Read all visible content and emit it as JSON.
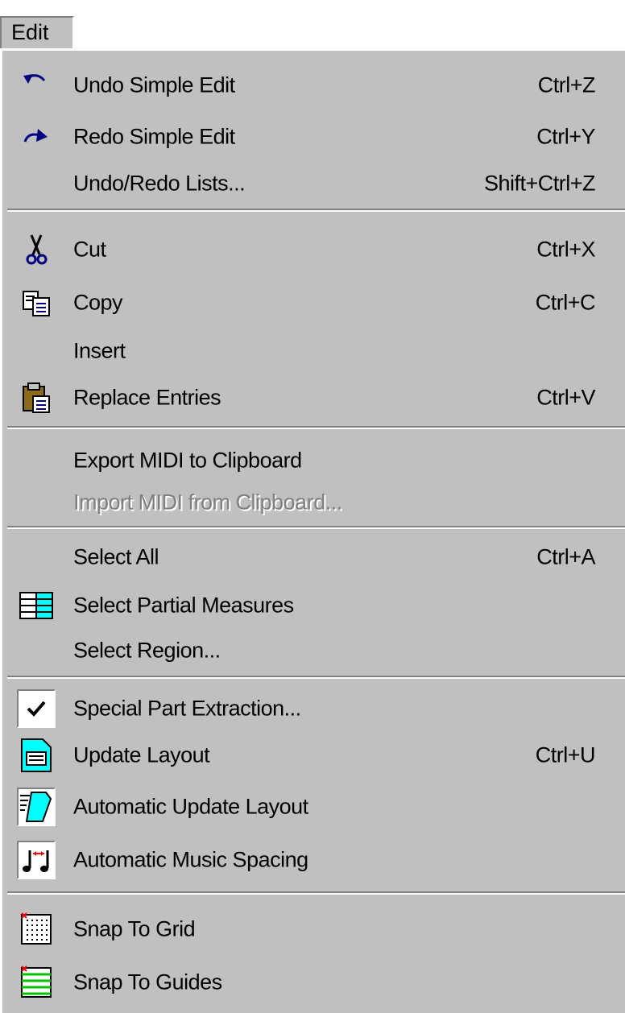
{
  "menu": {
    "title": "Edit",
    "items": {
      "undo": {
        "label": "Undo Simple Edit",
        "shortcut": "Ctrl+Z",
        "icon": "undo-arrow-icon"
      },
      "redo": {
        "label": "Redo Simple Edit",
        "shortcut": "Ctrl+Y",
        "icon": "redo-arrow-icon"
      },
      "undo_redo_lists": {
        "label": "Undo/Redo Lists...",
        "shortcut": "Shift+Ctrl+Z"
      },
      "cut": {
        "label": "Cut",
        "shortcut": "Ctrl+X",
        "icon": "scissors-icon"
      },
      "copy": {
        "label": "Copy",
        "shortcut": "Ctrl+C",
        "icon": "copy-pages-icon"
      },
      "insert": {
        "label": "Insert"
      },
      "replace_entries": {
        "label": "Replace Entries",
        "shortcut": "Ctrl+V",
        "icon": "clipboard-paste-icon"
      },
      "export_midi": {
        "label": "Export MIDI to Clipboard"
      },
      "import_midi": {
        "label": "Import MIDI from Clipboard...",
        "disabled": true
      },
      "select_all": {
        "label": "Select All",
        "shortcut": "Ctrl+A"
      },
      "select_partial": {
        "label": "Select Partial Measures",
        "icon": "partial-measures-icon"
      },
      "select_region": {
        "label": "Select Region..."
      },
      "special_part": {
        "label": "Special Part Extraction...",
        "checked": true,
        "icon": "checkmark-icon"
      },
      "update_layout": {
        "label": "Update Layout",
        "shortcut": "Ctrl+U",
        "icon": "update-layout-icon"
      },
      "auto_update_layout": {
        "label": "Automatic Update Layout",
        "icon": "auto-update-layout-icon"
      },
      "auto_spacing": {
        "label": "Automatic Music Spacing",
        "icon": "music-spacing-icon"
      },
      "snap_grid": {
        "label": "Snap To Grid",
        "icon": "grid-icon"
      },
      "snap_guides": {
        "label": "Snap To Guides",
        "icon": "guides-icon"
      }
    }
  },
  "colors": {
    "menu_bg": "#c0c0c0",
    "disabled_text": "#808080",
    "icon_cyan": "#00ffff",
    "icon_green": "#00ff00",
    "icon_red": "#ff0000",
    "icon_yellow": "#ffd84a"
  }
}
